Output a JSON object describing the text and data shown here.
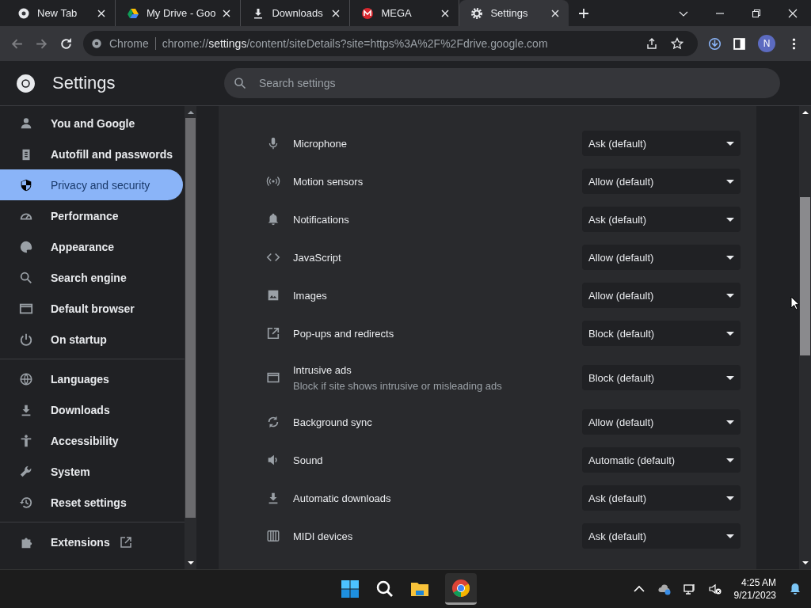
{
  "tabs": [
    {
      "title": "New Tab",
      "selected": false
    },
    {
      "title": "My Drive - Goo",
      "selected": false
    },
    {
      "title": "Downloads",
      "selected": false
    },
    {
      "title": "MEGA",
      "selected": false
    },
    {
      "title": "Settings",
      "selected": true
    }
  ],
  "toolbar": {
    "chip": "Chrome",
    "url": "chrome://**settings**/content/siteDetails?site=https%3A%2F%2Fdrive.google.com",
    "avatar": "N"
  },
  "header": {
    "title": "Settings",
    "search": {
      "placeholder": "Search settings"
    }
  },
  "sidebar": {
    "groups": [
      [
        {
          "label": "You and Google",
          "selected": false
        },
        {
          "label": "Autofill and passwords",
          "selected": false
        },
        {
          "label": "Privacy and security",
          "selected": true
        },
        {
          "label": "Performance",
          "selected": false
        },
        {
          "label": "Appearance",
          "selected": false
        },
        {
          "label": "Search engine",
          "selected": false
        },
        {
          "label": "Default browser",
          "selected": false
        },
        {
          "label": "On startup",
          "selected": false
        }
      ],
      [
        {
          "label": "Languages",
          "selected": false
        },
        {
          "label": "Downloads",
          "selected": false
        },
        {
          "label": "Accessibility",
          "selected": false
        },
        {
          "label": "System",
          "selected": false
        },
        {
          "label": "Reset settings",
          "selected": false
        }
      ],
      [
        {
          "label": "Extensions",
          "selected": false
        }
      ]
    ]
  },
  "permissions": [
    {
      "label": "Microphone",
      "value": "Ask (default)"
    },
    {
      "label": "Motion sensors",
      "value": "Allow (default)"
    },
    {
      "label": "Notifications",
      "value": "Ask (default)"
    },
    {
      "label": "JavaScript",
      "value": "Allow (default)"
    },
    {
      "label": "Images",
      "value": "Allow (default)"
    },
    {
      "label": "Pop-ups and redirects",
      "value": "Block (default)"
    },
    {
      "label": "Intrusive ads",
      "description": "Block if site shows intrusive or misleading ads",
      "value": "Block (default)"
    },
    {
      "label": "Background sync",
      "value": "Allow (default)"
    },
    {
      "label": "Sound",
      "value": "Automatic (default)"
    },
    {
      "label": "Automatic downloads",
      "value": "Ask (default)"
    },
    {
      "label": "MIDI devices",
      "value": "Ask (default)"
    }
  ],
  "taskbar": {
    "time": "4:25 AM",
    "date": "9/21/2023"
  }
}
